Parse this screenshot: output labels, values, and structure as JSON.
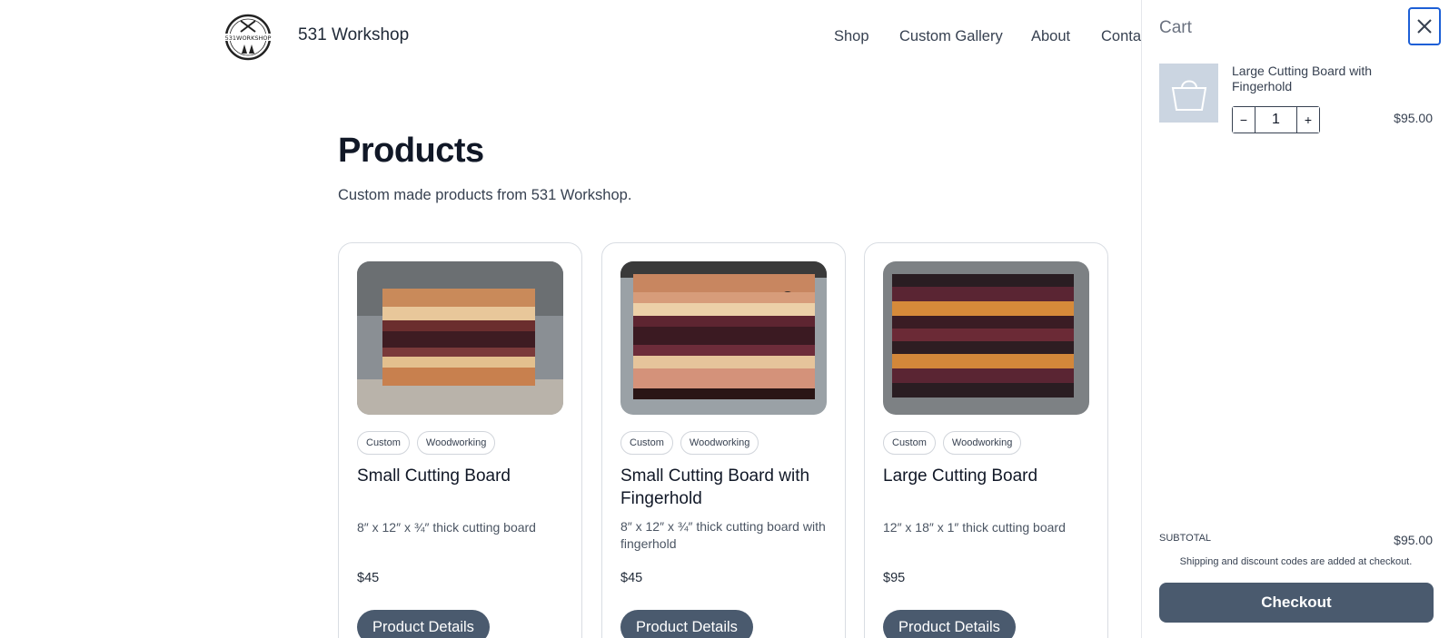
{
  "header": {
    "brand": "531 Workshop",
    "logo_text": "531WORKSHOP",
    "nav": [
      "Shop",
      "Custom Gallery",
      "About",
      "Conta"
    ]
  },
  "main": {
    "title": "Products",
    "description": "Custom made products from 531 Workshop.",
    "products": [
      {
        "tags": [
          "Custom",
          "Woodworking"
        ],
        "title": "Small Cutting Board",
        "description": "8″ x 12″ x ¾″ thick cutting board",
        "price": "$45",
        "button": "Product Details"
      },
      {
        "tags": [
          "Custom",
          "Woodworking"
        ],
        "title": "Small Cutting Board with Fingerhold",
        "description": "8″ x 12″ x ¾″ thick cutting board with fingerhold",
        "price": "$45",
        "button": "Product Details"
      },
      {
        "tags": [
          "Custom",
          "Woodworking"
        ],
        "title": "Large Cutting Board",
        "description": "12″ x 18″ x 1″ thick cutting board",
        "price": "$95",
        "button": "Product Details"
      }
    ]
  },
  "cart": {
    "title": "Cart",
    "close_icon": "close-icon",
    "items": [
      {
        "name": "Large Cutting Board with Fingerhold",
        "quantity": "1",
        "minus": "−",
        "plus": "+",
        "price": "$95.00",
        "thumbnail_icon": "shopping-bag-icon"
      }
    ],
    "subtotal_label": "SUBTOTAL",
    "subtotal_value": "$95.00",
    "shipping_note": "Shipping and discount codes are added at checkout.",
    "checkout_label": "Checkout"
  },
  "colors": {
    "button": "#4a5a6e",
    "focus_ring": "#1d5fd6",
    "thumb_bg": "#cbd5e1"
  }
}
